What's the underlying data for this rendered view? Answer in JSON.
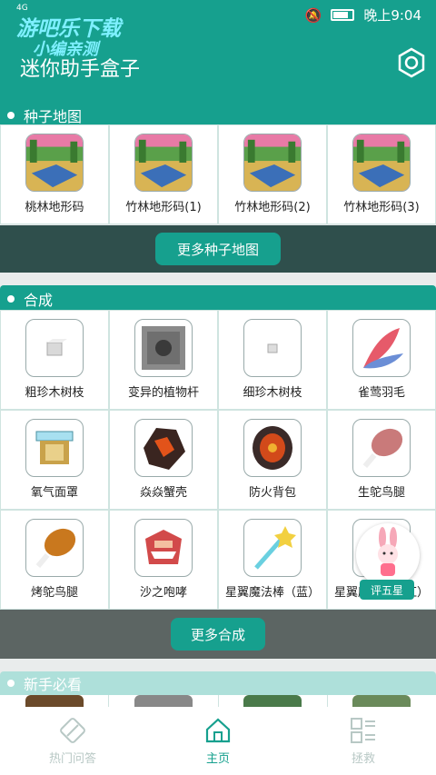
{
  "status_bar": {
    "signal": "4G",
    "time": "晚上9:04"
  },
  "watermark": {
    "line1": "游吧乐下载",
    "line2": "小编亲测"
  },
  "header": {
    "title": "迷你助手盒子"
  },
  "seed_section": {
    "title": "种子地图",
    "items": [
      {
        "label": "桃林地形码"
      },
      {
        "label": "竹林地形码(1)"
      },
      {
        "label": "竹林地形码(2)"
      },
      {
        "label": "竹林地形码(3)"
      }
    ],
    "more_label": "更多种子地图"
  },
  "craft_section": {
    "title": "合成",
    "items": [
      {
        "label": "粗珍木树枝",
        "icon": "small-block-icon"
      },
      {
        "label": "变异的植物杆",
        "icon": "stone-block-icon"
      },
      {
        "label": "细珍木树枝",
        "icon": "tiny-block-icon"
      },
      {
        "label": "雀莺羽毛",
        "icon": "feather-icon"
      },
      {
        "label": "氧气面罩",
        "icon": "oxygen-mask-icon"
      },
      {
        "label": "焱焱蟹壳",
        "icon": "crab-shell-icon"
      },
      {
        "label": "防火背包",
        "icon": "backpack-icon"
      },
      {
        "label": "生鸵鸟腿",
        "icon": "raw-leg-icon"
      },
      {
        "label": "烤鸵鸟腿",
        "icon": "roast-leg-icon"
      },
      {
        "label": "沙之咆哮",
        "icon": "sand-roar-icon"
      },
      {
        "label": "星翼魔法棒（蓝）",
        "icon": "magic-wand-icon"
      },
      {
        "label": "星翼魔法棒（红）",
        "icon": "magic-wand-red-icon"
      }
    ],
    "more_label": "更多合成"
  },
  "newbie_section": {
    "title": "新手必看"
  },
  "rate_badge": {
    "label": "评五星"
  },
  "bottom_nav": [
    {
      "label": "热门问答",
      "icon": "compass-icon",
      "active": false
    },
    {
      "label": "主页",
      "icon": "home-icon",
      "active": true
    },
    {
      "label": "拯救",
      "icon": "grid-icon",
      "active": false
    }
  ],
  "colors": {
    "accent": "#16a08e",
    "dark_band": "#2f4f4c"
  }
}
